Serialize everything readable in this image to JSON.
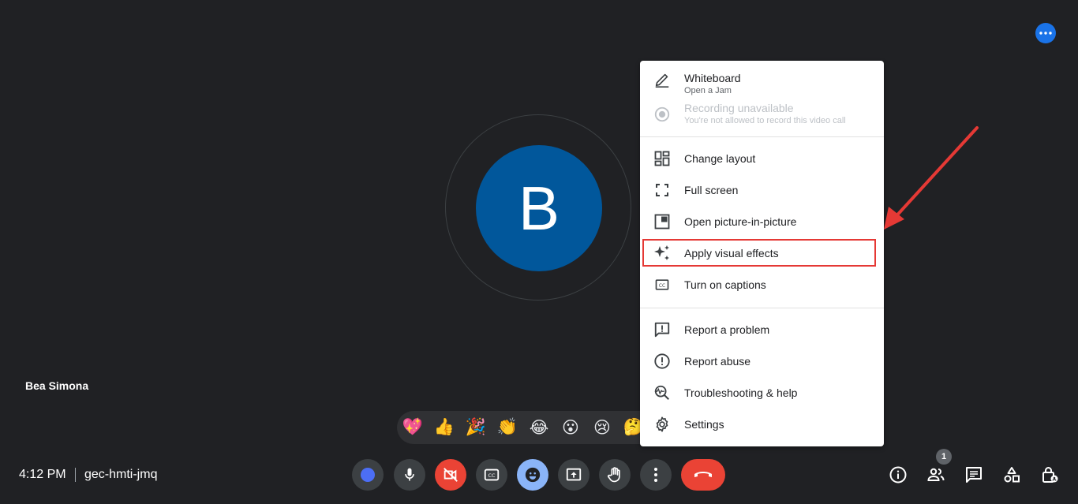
{
  "call": {
    "time": "4:12 PM",
    "meeting_code": "gec-hmti-jmq",
    "participant_name": "Bea Simona",
    "avatar_letter": "B",
    "participant_count": "1"
  },
  "reactions": [
    "💖",
    "👍",
    "🎉",
    "👏",
    "😂",
    "😮",
    "😢",
    "🤔"
  ],
  "menu": {
    "whiteboard_label": "Whiteboard",
    "whiteboard_sub": "Open a Jam",
    "recording_label": "Recording unavailable",
    "recording_sub": "You're not allowed to record this video call",
    "change_layout": "Change layout",
    "full_screen": "Full screen",
    "pip": "Open picture-in-picture",
    "visual_effects": "Apply visual effects",
    "captions": "Turn on captions",
    "report_problem": "Report a problem",
    "report_abuse": "Report abuse",
    "troubleshooting": "Troubleshooting & help",
    "settings": "Settings"
  },
  "colors": {
    "background": "#202124",
    "avatar": "#01579b",
    "end_call": "#ea4335",
    "highlight": "#e53935",
    "accent": "#1a73e8"
  }
}
